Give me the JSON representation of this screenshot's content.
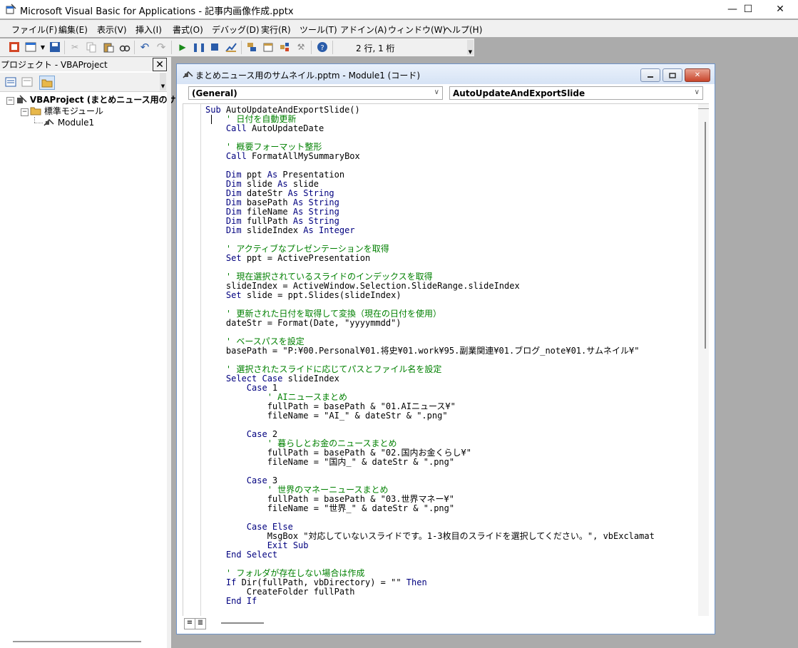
{
  "window": {
    "title": "Microsoft Visual Basic for Applications - 記事内画像作成.pptx",
    "minimize": "—",
    "maximize": "☐",
    "close": "✕"
  },
  "menu": [
    "ファイル(F)",
    "編集(E)",
    "表示(V)",
    "挿入(I)",
    "書式(O)",
    "デバッグ(D)",
    "実行(R)",
    "ツール(T)",
    "アドイン(A)",
    "ウィンドウ(W)",
    "ヘルプ(H)"
  ],
  "toolbar": {
    "position": "2 行, 1 桁"
  },
  "project": {
    "title": "プロジェクト - VBAProject",
    "close": "✕",
    "tree": {
      "root": "VBAProject (まとめニュース用のサムネ",
      "folder": "標準モジュール",
      "module": "Module1"
    }
  },
  "code_window": {
    "title": "まとめニュース用のサムネイル.pptm - Module1 (コード)",
    "object_combo": "(General)",
    "procedure_combo": "AutoUpdateAndExportSlide",
    "lines": [
      [
        {
          "t": "Sub",
          "c": "kw"
        },
        {
          "t": " AutoUpdateAndExportSlide()"
        }
      ],
      [
        {
          "t": "    "
        },
        {
          "t": "' 日付を自動更新",
          "c": "cm"
        }
      ],
      [
        {
          "t": "    "
        },
        {
          "t": "Call",
          "c": "kw"
        },
        {
          "t": " AutoUpdateDate"
        }
      ],
      [
        {
          "t": ""
        }
      ],
      [
        {
          "t": "    "
        },
        {
          "t": "' 概要フォーマット整形",
          "c": "cm"
        }
      ],
      [
        {
          "t": "    "
        },
        {
          "t": "Call",
          "c": "kw"
        },
        {
          "t": " FormatAllMySummaryBox"
        }
      ],
      [
        {
          "t": ""
        }
      ],
      [
        {
          "t": "    "
        },
        {
          "t": "Dim",
          "c": "kw"
        },
        {
          "t": " ppt "
        },
        {
          "t": "As",
          "c": "kw"
        },
        {
          "t": " Presentation"
        }
      ],
      [
        {
          "t": "    "
        },
        {
          "t": "Dim",
          "c": "kw"
        },
        {
          "t": " slide "
        },
        {
          "t": "As",
          "c": "kw"
        },
        {
          "t": " slide"
        }
      ],
      [
        {
          "t": "    "
        },
        {
          "t": "Dim",
          "c": "kw"
        },
        {
          "t": " dateStr "
        },
        {
          "t": "As String",
          "c": "kw"
        }
      ],
      [
        {
          "t": "    "
        },
        {
          "t": "Dim",
          "c": "kw"
        },
        {
          "t": " basePath "
        },
        {
          "t": "As String",
          "c": "kw"
        }
      ],
      [
        {
          "t": "    "
        },
        {
          "t": "Dim",
          "c": "kw"
        },
        {
          "t": " fileName "
        },
        {
          "t": "As String",
          "c": "kw"
        }
      ],
      [
        {
          "t": "    "
        },
        {
          "t": "Dim",
          "c": "kw"
        },
        {
          "t": " fullPath "
        },
        {
          "t": "As String",
          "c": "kw"
        }
      ],
      [
        {
          "t": "    "
        },
        {
          "t": "Dim",
          "c": "kw"
        },
        {
          "t": " slideIndex "
        },
        {
          "t": "As Integer",
          "c": "kw"
        }
      ],
      [
        {
          "t": ""
        }
      ],
      [
        {
          "t": "    "
        },
        {
          "t": "' アクティブなプレゼンテーションを取得",
          "c": "cm"
        }
      ],
      [
        {
          "t": "    "
        },
        {
          "t": "Set",
          "c": "kw"
        },
        {
          "t": " ppt = ActivePresentation"
        }
      ],
      [
        {
          "t": ""
        }
      ],
      [
        {
          "t": "    "
        },
        {
          "t": "' 現在選択されているスライドのインデックスを取得",
          "c": "cm"
        }
      ],
      [
        {
          "t": "    slideIndex = ActiveWindow.Selection.SlideRange.slideIndex"
        }
      ],
      [
        {
          "t": "    "
        },
        {
          "t": "Set",
          "c": "kw"
        },
        {
          "t": " slide = ppt.Slides(slideIndex)"
        }
      ],
      [
        {
          "t": ""
        }
      ],
      [
        {
          "t": "    "
        },
        {
          "t": "' 更新された日付を取得して変換（現在の日付を使用）",
          "c": "cm"
        }
      ],
      [
        {
          "t": "    dateStr = Format(Date, \"yyyymmdd\")"
        }
      ],
      [
        {
          "t": ""
        }
      ],
      [
        {
          "t": "    "
        },
        {
          "t": "' ベースパスを設定",
          "c": "cm"
        }
      ],
      [
        {
          "t": "    basePath = \"P:¥00.Personal¥01.将史¥01.work¥95.副業関連¥01.ブログ_note¥01.サムネイル¥\""
        }
      ],
      [
        {
          "t": ""
        }
      ],
      [
        {
          "t": "    "
        },
        {
          "t": "' 選択されたスライドに応じてパスとファイル名を設定",
          "c": "cm"
        }
      ],
      [
        {
          "t": "    "
        },
        {
          "t": "Select Case",
          "c": "kw"
        },
        {
          "t": " slideIndex"
        }
      ],
      [
        {
          "t": "        "
        },
        {
          "t": "Case",
          "c": "kw"
        },
        {
          "t": " 1"
        }
      ],
      [
        {
          "t": "            "
        },
        {
          "t": "' AIニュースまとめ",
          "c": "cm"
        }
      ],
      [
        {
          "t": "            fullPath = basePath & \"01.AIニュース¥\""
        }
      ],
      [
        {
          "t": "            fileName = \"AI_\" & dateStr & \".png\""
        }
      ],
      [
        {
          "t": ""
        }
      ],
      [
        {
          "t": "        "
        },
        {
          "t": "Case",
          "c": "kw"
        },
        {
          "t": " 2"
        }
      ],
      [
        {
          "t": "            "
        },
        {
          "t": "' 暮らしとお金のニュースまとめ",
          "c": "cm"
        }
      ],
      [
        {
          "t": "            fullPath = basePath & \"02.国内お金くらし¥\""
        }
      ],
      [
        {
          "t": "            fileName = \"国内_\" & dateStr & \".png\""
        }
      ],
      [
        {
          "t": ""
        }
      ],
      [
        {
          "t": "        "
        },
        {
          "t": "Case",
          "c": "kw"
        },
        {
          "t": " 3"
        }
      ],
      [
        {
          "t": "            "
        },
        {
          "t": "' 世界のマネーニュースまとめ",
          "c": "cm"
        }
      ],
      [
        {
          "t": "            fullPath = basePath & \"03.世界マネー¥\""
        }
      ],
      [
        {
          "t": "            fileName = \"世界_\" & dateStr & \".png\""
        }
      ],
      [
        {
          "t": ""
        }
      ],
      [
        {
          "t": "        "
        },
        {
          "t": "Case Else",
          "c": "kw"
        }
      ],
      [
        {
          "t": "            MsgBox \"対応していないスライドです。1-3枚目のスライドを選択してください。\", vbExclamat"
        }
      ],
      [
        {
          "t": "            "
        },
        {
          "t": "Exit Sub",
          "c": "kw"
        }
      ],
      [
        {
          "t": "    "
        },
        {
          "t": "End Select",
          "c": "kw"
        }
      ],
      [
        {
          "t": ""
        }
      ],
      [
        {
          "t": "    "
        },
        {
          "t": "' フォルダが存在しない場合は作成",
          "c": "cm"
        }
      ],
      [
        {
          "t": "    "
        },
        {
          "t": "If",
          "c": "kw"
        },
        {
          "t": " Dir(fullPath, vbDirectory) = \"\" "
        },
        {
          "t": "Then",
          "c": "kw"
        }
      ],
      [
        {
          "t": "        CreateFolder fullPath"
        }
      ],
      [
        {
          "t": "    "
        },
        {
          "t": "End If",
          "c": "kw"
        }
      ]
    ]
  },
  "colors": {
    "keyword": "#00007f",
    "comment": "#008000",
    "code_border": "#6e93c8"
  }
}
